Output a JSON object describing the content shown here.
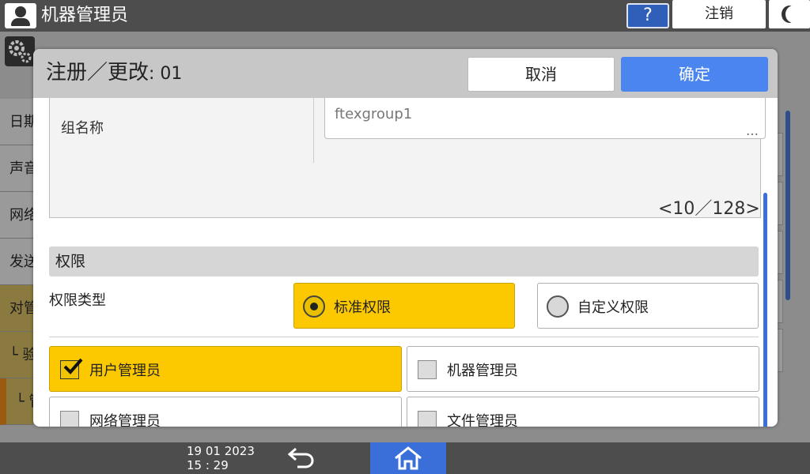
{
  "topbar": {
    "title": "机器管理员",
    "help_label": "?",
    "logout_label": "注销"
  },
  "background": {
    "sidebar_items": [
      "日期",
      "声音",
      "网络",
      "发送",
      "对管",
      "└ 验",
      "└ 管 A"
    ]
  },
  "dialog": {
    "title": "注册／更改",
    "title_number": ": 01",
    "cancel_label": "取消",
    "ok_label": "确定",
    "group_name_label": "组名称",
    "group_name_value": "ftexgroup1",
    "group_name_more": "…",
    "char_count": "<10／128>",
    "section_title": "权限",
    "permission_type_label": "权限类型",
    "permission_types": [
      {
        "label": "标准权限",
        "selected": true
      },
      {
        "label": "自定义权限",
        "selected": false
      }
    ],
    "admin_roles": [
      {
        "label": "用户管理员",
        "checked": true
      },
      {
        "label": "机器管理员",
        "checked": false
      },
      {
        "label": "网络管理员",
        "checked": false
      },
      {
        "label": "文件管理员",
        "checked": false
      }
    ]
  },
  "bottombar": {
    "date": "19 01 2023",
    "time": "15 : 29"
  },
  "colors": {
    "accent_blue": "#4a85f0",
    "selected_yellow": "#fcc800",
    "bar_dark": "#4d4d4d"
  }
}
